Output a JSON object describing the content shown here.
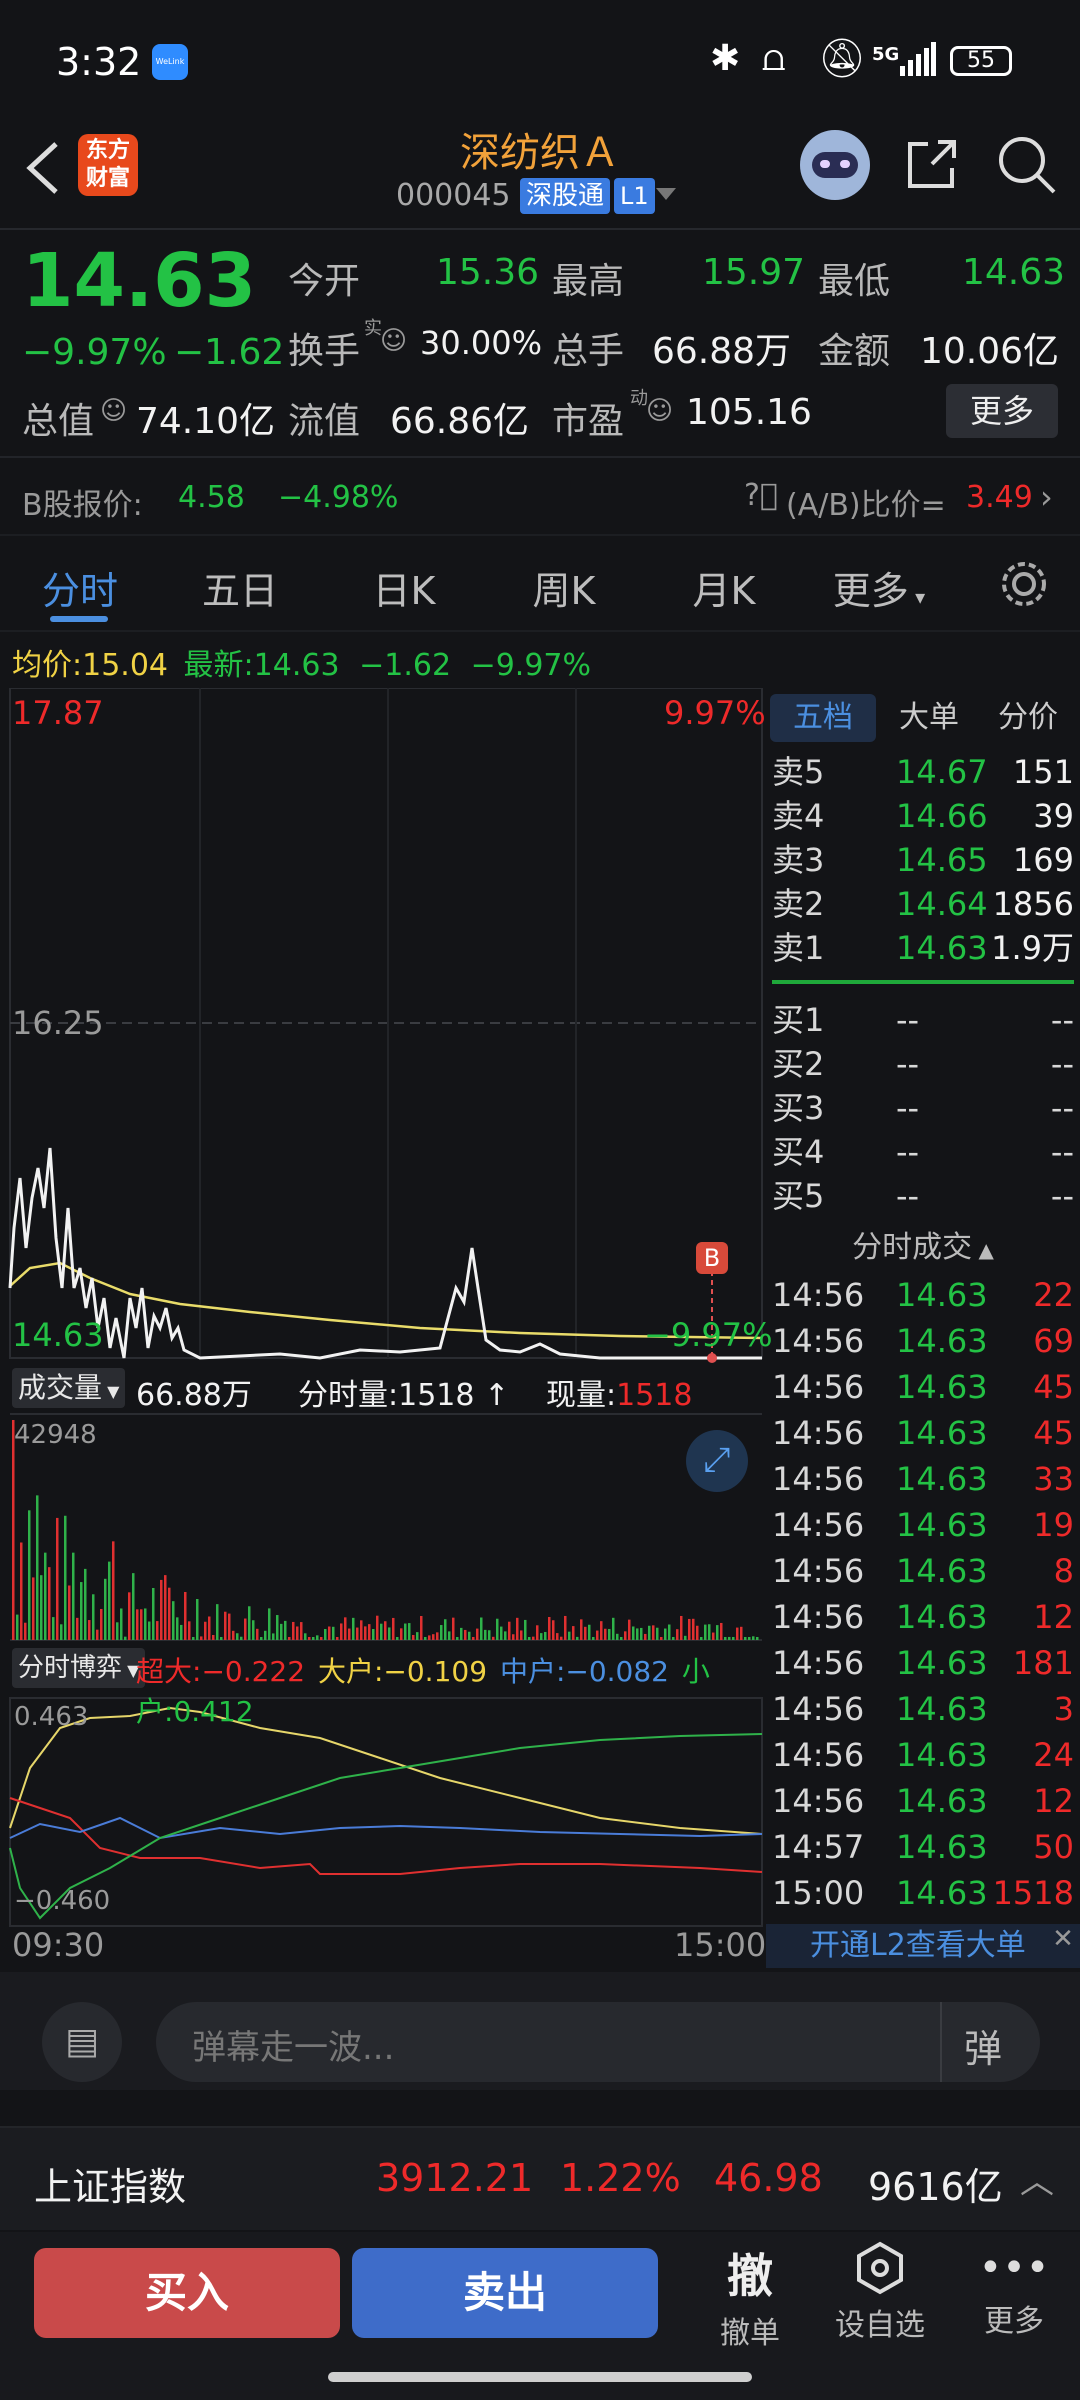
{
  "status": {
    "time": "3:32",
    "battery": "55",
    "network": "5G"
  },
  "header": {
    "logo_line1": "东方",
    "logo_line2": "财富",
    "title": "深纺织Ａ",
    "code": "000045",
    "badge_connect": "深股通",
    "badge_level": "L1"
  },
  "quote": {
    "price": "14.63",
    "change_pct": "−9.97%",
    "change": "−1.62",
    "open_label": "今开",
    "open": "15.36",
    "high_label": "最高",
    "high": "15.97",
    "low_label": "最低",
    "low": "14.63",
    "turnover_label": "换手",
    "turnover_sup": "实",
    "turnover": "30.00%",
    "volume_label": "总手",
    "volume": "66.88万",
    "amount_label": "金额",
    "amount": "10.06亿",
    "mktcap_label": "总值",
    "mktcap": "74.10亿",
    "float_label": "流值",
    "float": "66.86亿",
    "pe_label": "市盈",
    "pe_sup": "动",
    "pe": "105.16",
    "more": "更多"
  },
  "bshare": {
    "label": "B股报价:",
    "price": "4.58",
    "pct": "−4.98%",
    "ratio_label": "(A/B)比价=",
    "ratio": "3.49"
  },
  "tabs": [
    "分时",
    "五日",
    "日K",
    "周K",
    "月K",
    "更多"
  ],
  "chart_info": {
    "avg_label": "均价:",
    "avg": "15.04",
    "latest_label": "最新:",
    "latest": "14.63",
    "chg": "−1.62",
    "pct": "−9.97%"
  },
  "chart_data": {
    "type": "line",
    "y_top": "17.87",
    "y_mid": "16.25",
    "y_bottom": "14.63",
    "pct_top": "9.97%",
    "pct_bottom": "−9.97%",
    "x_start": "09:30",
    "x_end": "15:00",
    "marker": "B",
    "ylim": [
      14.63,
      17.87
    ]
  },
  "volume_bar": {
    "label": "成交量",
    "total": "66.88万",
    "tick_label": "分时量:",
    "tick": "1518",
    "cur_label": "现量:",
    "cur": "1518",
    "max": "42948"
  },
  "flow": {
    "label": "分时博弈",
    "super_label": "超大:",
    "super": "−0.222",
    "large_label": "大户:",
    "large": "−0.109",
    "mid_label": "中户:",
    "mid": "−0.082",
    "small_label": "小户:",
    "small": "0.412",
    "top": "0.463",
    "bottom": "−0.460"
  },
  "orderbook": {
    "tabs": [
      "五档",
      "大单",
      "分价"
    ],
    "asks": [
      {
        "label": "卖5",
        "price": "14.67",
        "vol": "151"
      },
      {
        "label": "卖4",
        "price": "14.66",
        "vol": "39"
      },
      {
        "label": "卖3",
        "price": "14.65",
        "vol": "169"
      },
      {
        "label": "卖2",
        "price": "14.64",
        "vol": "1856"
      },
      {
        "label": "卖1",
        "price": "14.63",
        "vol": "1.9万"
      }
    ],
    "bids": [
      {
        "label": "买1",
        "price": "--",
        "vol": "--"
      },
      {
        "label": "买2",
        "price": "--",
        "vol": "--"
      },
      {
        "label": "买3",
        "price": "--",
        "vol": "--"
      },
      {
        "label": "买4",
        "price": "--",
        "vol": "--"
      },
      {
        "label": "买5",
        "price": "--",
        "vol": "--"
      }
    ],
    "trades_title": "分时成交",
    "trades": [
      {
        "t": "14:56",
        "p": "14.63",
        "v": "22"
      },
      {
        "t": "14:56",
        "p": "14.63",
        "v": "69"
      },
      {
        "t": "14:56",
        "p": "14.63",
        "v": "45"
      },
      {
        "t": "14:56",
        "p": "14.63",
        "v": "45"
      },
      {
        "t": "14:56",
        "p": "14.63",
        "v": "33"
      },
      {
        "t": "14:56",
        "p": "14.63",
        "v": "19"
      },
      {
        "t": "14:56",
        "p": "14.63",
        "v": "8"
      },
      {
        "t": "14:56",
        "p": "14.63",
        "v": "12"
      },
      {
        "t": "14:56",
        "p": "14.63",
        "v": "181"
      },
      {
        "t": "14:56",
        "p": "14.63",
        "v": "3"
      },
      {
        "t": "14:56",
        "p": "14.63",
        "v": "24"
      },
      {
        "t": "14:56",
        "p": "14.63",
        "v": "12"
      },
      {
        "t": "14:57",
        "p": "14.63",
        "v": "50"
      },
      {
        "t": "15:00",
        "p": "14.63",
        "v": "1518"
      }
    ],
    "l2_banner": "开通L2查看大单"
  },
  "danmu": {
    "placeholder": "弹幕走一波...",
    "send": "弹"
  },
  "index": {
    "name": "上证指数",
    "value": "3912.21",
    "pct": "1.22%",
    "chg": "46.98",
    "amount": "9616亿"
  },
  "bottom": {
    "buy": "买入",
    "sell": "卖出",
    "cancel_icon": "撤",
    "cancel": "撤单",
    "watch": "设自选",
    "more": "更多"
  }
}
